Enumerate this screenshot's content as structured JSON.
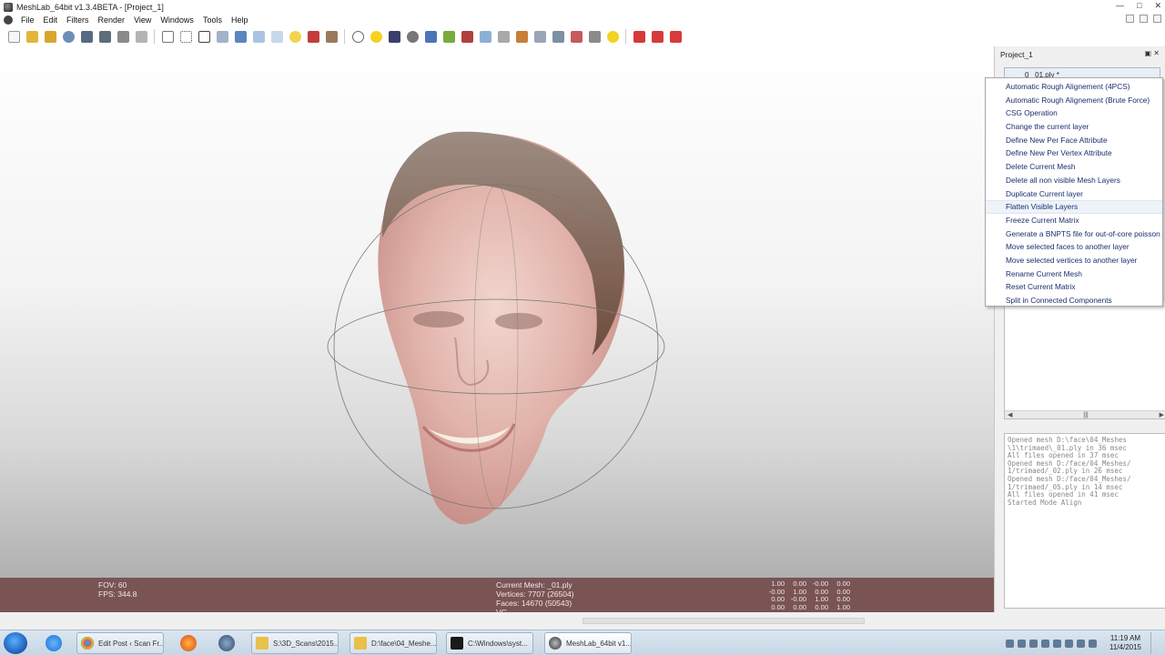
{
  "window": {
    "title": "MeshLab_64bit v1.3.4BETA - [Project_1]"
  },
  "menu": [
    "File",
    "Edit",
    "Filters",
    "Render",
    "View",
    "Windows",
    "Tools",
    "Help"
  ],
  "viewport_info": {
    "fov": "FOV: 60",
    "fps": "FPS:   344.8",
    "current_mesh": "Current Mesh: _01.ply",
    "vertices": "Vertices: 7707 (26504)",
    "faces": "Faces: 14670 (50543)",
    "vc": "VC",
    "matrix": [
      [
        "1.00",
        "0.00",
        "-0.00",
        "0.00"
      ],
      [
        "-0.00",
        "1.00",
        "0.00",
        "0.00"
      ],
      [
        "0.00",
        "-0.00",
        "1.00",
        "0.00"
      ],
      [
        "0.00",
        "0.00",
        "0.00",
        "1.00"
      ]
    ]
  },
  "panel": {
    "title": "Project_1",
    "layer_label": "0 _01.ply *"
  },
  "context_menu": [
    "Automatic Rough Alignement (4PCS)",
    "Automatic Rough Alignement (Brute Force)",
    "CSG Operation",
    "Change the current layer",
    "Define New Per Face Attribute",
    "Define New Per Vertex Attribute",
    "Delete Current Mesh",
    "Delete all non visible Mesh Layers",
    "Duplicate Current layer",
    "Flatten Visible Layers",
    "Freeze Current Matrix",
    "Generate a BNPTS file for out-of-core poisson",
    "Move selected faces to another layer",
    "Move selected vertices to another layer",
    "Rename Current Mesh",
    "Reset Current Matrix",
    "Split in Connected Components"
  ],
  "log": "Opened mesh D:\\face\\04_Meshes\n\\1\\trimaed\\_01.ply in 36 msec\nAll files opened in 37 msec\nOpened mesh D:/face/04_Meshes/\n1/trimaed/_02.ply in 26 msec\nOpened mesh D:/face/04_Meshes/\n1/trimaed/_05.ply in 14 msec\nAll files opened in 41 msec\nStarted Mode Align",
  "taskbar": {
    "tasks": [
      "Edit Post ‹ Scan Fr...",
      "S:\\3D_Scans\\2015...",
      "D:\\face\\04_Meshe...",
      "C:\\Windows\\syst...",
      "MeshLab_64bit v1..."
    ],
    "time": "11:19 AM",
    "date": "11/4/2015"
  },
  "colors": {
    "infobar_bg": "#7a5454",
    "menu_text": "#1a2e6e",
    "hover_bg": "#eef3fa"
  }
}
